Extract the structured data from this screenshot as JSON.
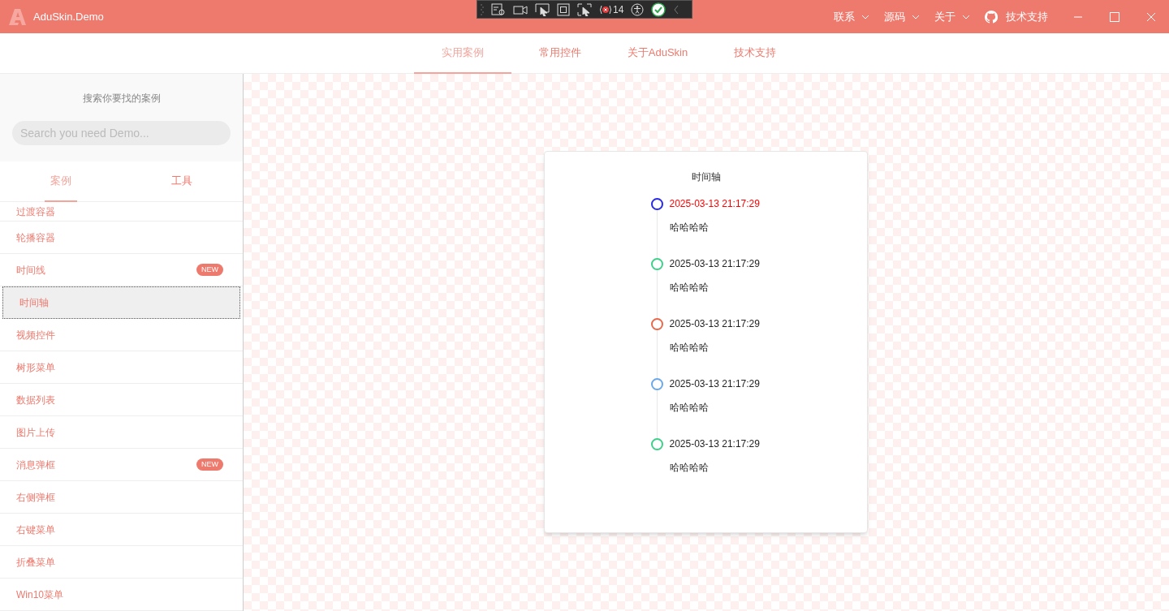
{
  "window": {
    "title": "AduSkin.Demo"
  },
  "debug_toolbar": {
    "count": "14"
  },
  "title_menu": [
    {
      "label": "联系",
      "kind": "dropdown"
    },
    {
      "label": "源码",
      "kind": "dropdown"
    },
    {
      "label": "关于",
      "kind": "dropdown"
    },
    {
      "label": "技术支持",
      "kind": "github"
    }
  ],
  "nav_tabs": [
    {
      "label": "实用案例",
      "selected": true
    },
    {
      "label": "常用控件",
      "selected": false
    },
    {
      "label": "关于AduSkin",
      "selected": false
    },
    {
      "label": "技术支持",
      "selected": false
    }
  ],
  "sidebar": {
    "search_title": "搜索你要找的案例",
    "search": {
      "placeholder": "Search you need Demo..."
    },
    "tabs": [
      {
        "label": "案例",
        "selected": true
      },
      {
        "label": "工具",
        "selected": false
      }
    ],
    "items": [
      {
        "label": "过渡容器",
        "selected": false
      },
      {
        "label": "轮播容器",
        "selected": false
      },
      {
        "label": "时间线",
        "selected": false,
        "badge": "NEW"
      },
      {
        "label": "时间轴",
        "selected": true
      },
      {
        "label": "视频控件",
        "selected": false
      },
      {
        "label": "树形菜单",
        "selected": false
      },
      {
        "label": "数据列表",
        "selected": false
      },
      {
        "label": "图片上传",
        "selected": false
      },
      {
        "label": "消息弹框",
        "selected": false,
        "badge": "NEW"
      },
      {
        "label": "右侧弹框",
        "selected": false
      },
      {
        "label": "右键菜单",
        "selected": false
      },
      {
        "label": "折叠菜单",
        "selected": false
      },
      {
        "label": "Win10菜单",
        "selected": false
      }
    ]
  },
  "timeline": {
    "title": "时间轴",
    "events": [
      {
        "time": "2025-03-13 21:17:29",
        "text": "哈哈哈哈",
        "color": "#2a2ae6",
        "highlighted": true
      },
      {
        "time": "2025-03-13 21:17:29",
        "text": "哈哈哈哈",
        "color": "#3ecf8a",
        "highlighted": false
      },
      {
        "time": "2025-03-13 21:17:29",
        "text": "哈哈哈哈",
        "color": "#e8684a",
        "highlighted": false
      },
      {
        "time": "2025-03-13 21:17:29",
        "text": "哈哈哈哈",
        "color": "#6aa8ea",
        "highlighted": false
      },
      {
        "time": "2025-03-13 21:17:29",
        "text": "哈哈哈哈",
        "color": "#3ecf8a",
        "highlighted": false
      }
    ]
  }
}
